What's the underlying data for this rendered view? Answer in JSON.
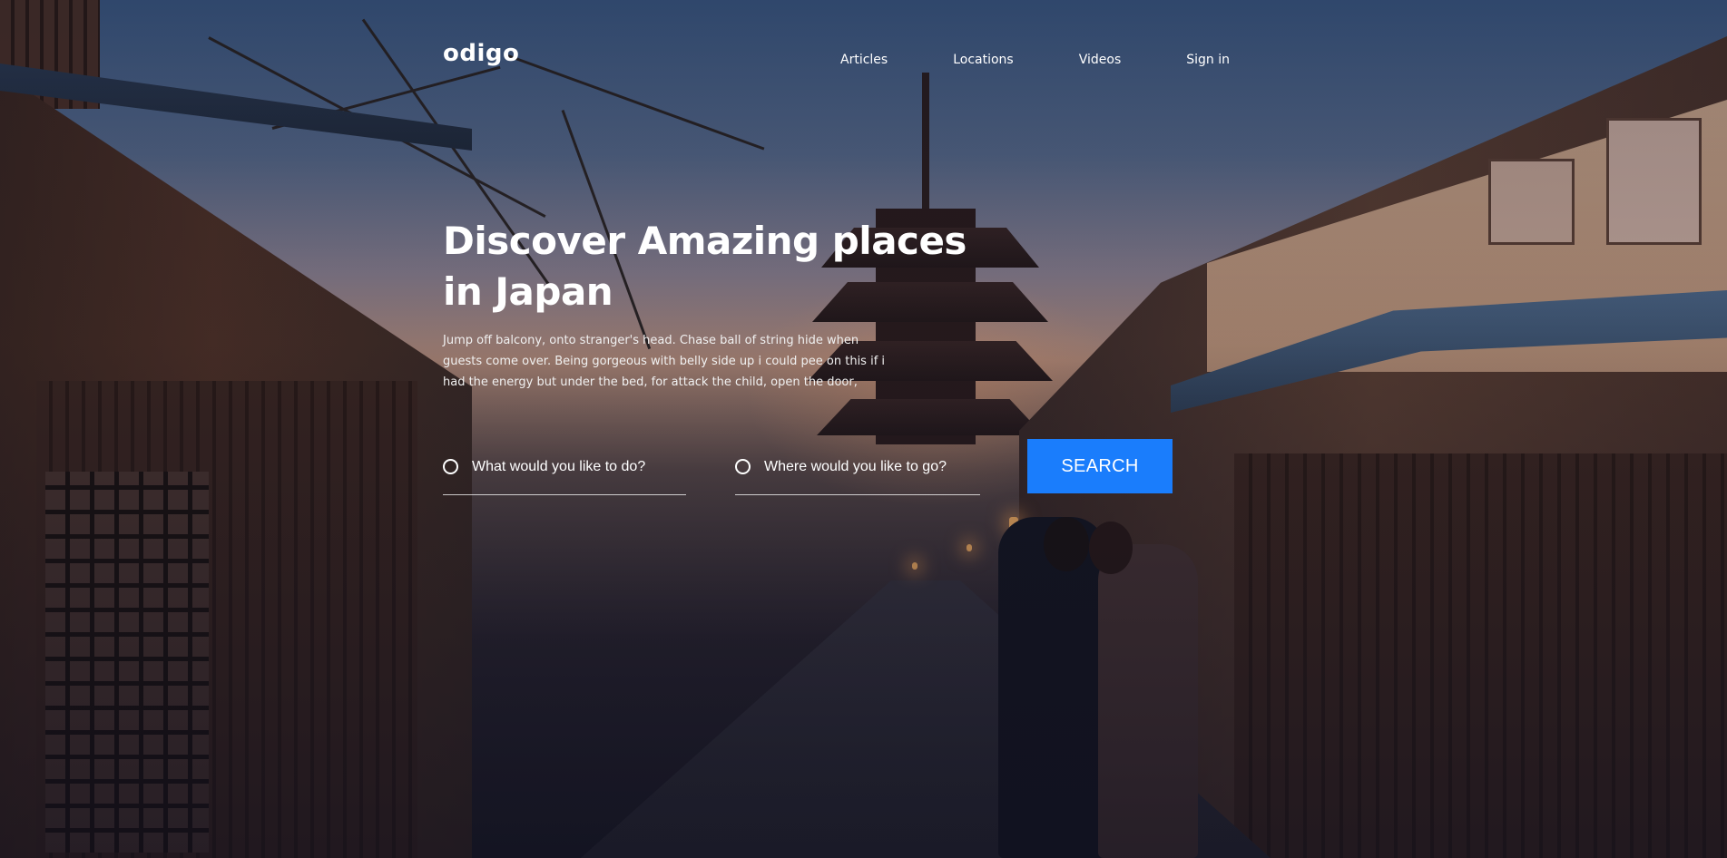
{
  "brand": {
    "logo_text": "odigo"
  },
  "nav": {
    "items": [
      {
        "label": "Articles"
      },
      {
        "label": "Locations"
      },
      {
        "label": "Videos"
      },
      {
        "label": "Sign in"
      }
    ]
  },
  "hero": {
    "headline": "Discover Amazing places in Japan",
    "description": "Jump off balcony, onto stranger's head. Chase ball of string hide when guests come over. Being gorgeous with belly side up i could pee on this if i had the energy but under the bed, for attack the child, open the door,"
  },
  "search": {
    "activity_placeholder": "What would you like to do?",
    "activity_icon": "radio-circle-icon",
    "location_placeholder": "Where would you like to go?",
    "location_icon": "radio-circle-icon",
    "button_label": "SEARCH"
  },
  "colors": {
    "accent": "#1a7dfc",
    "text": "#ffffff"
  }
}
